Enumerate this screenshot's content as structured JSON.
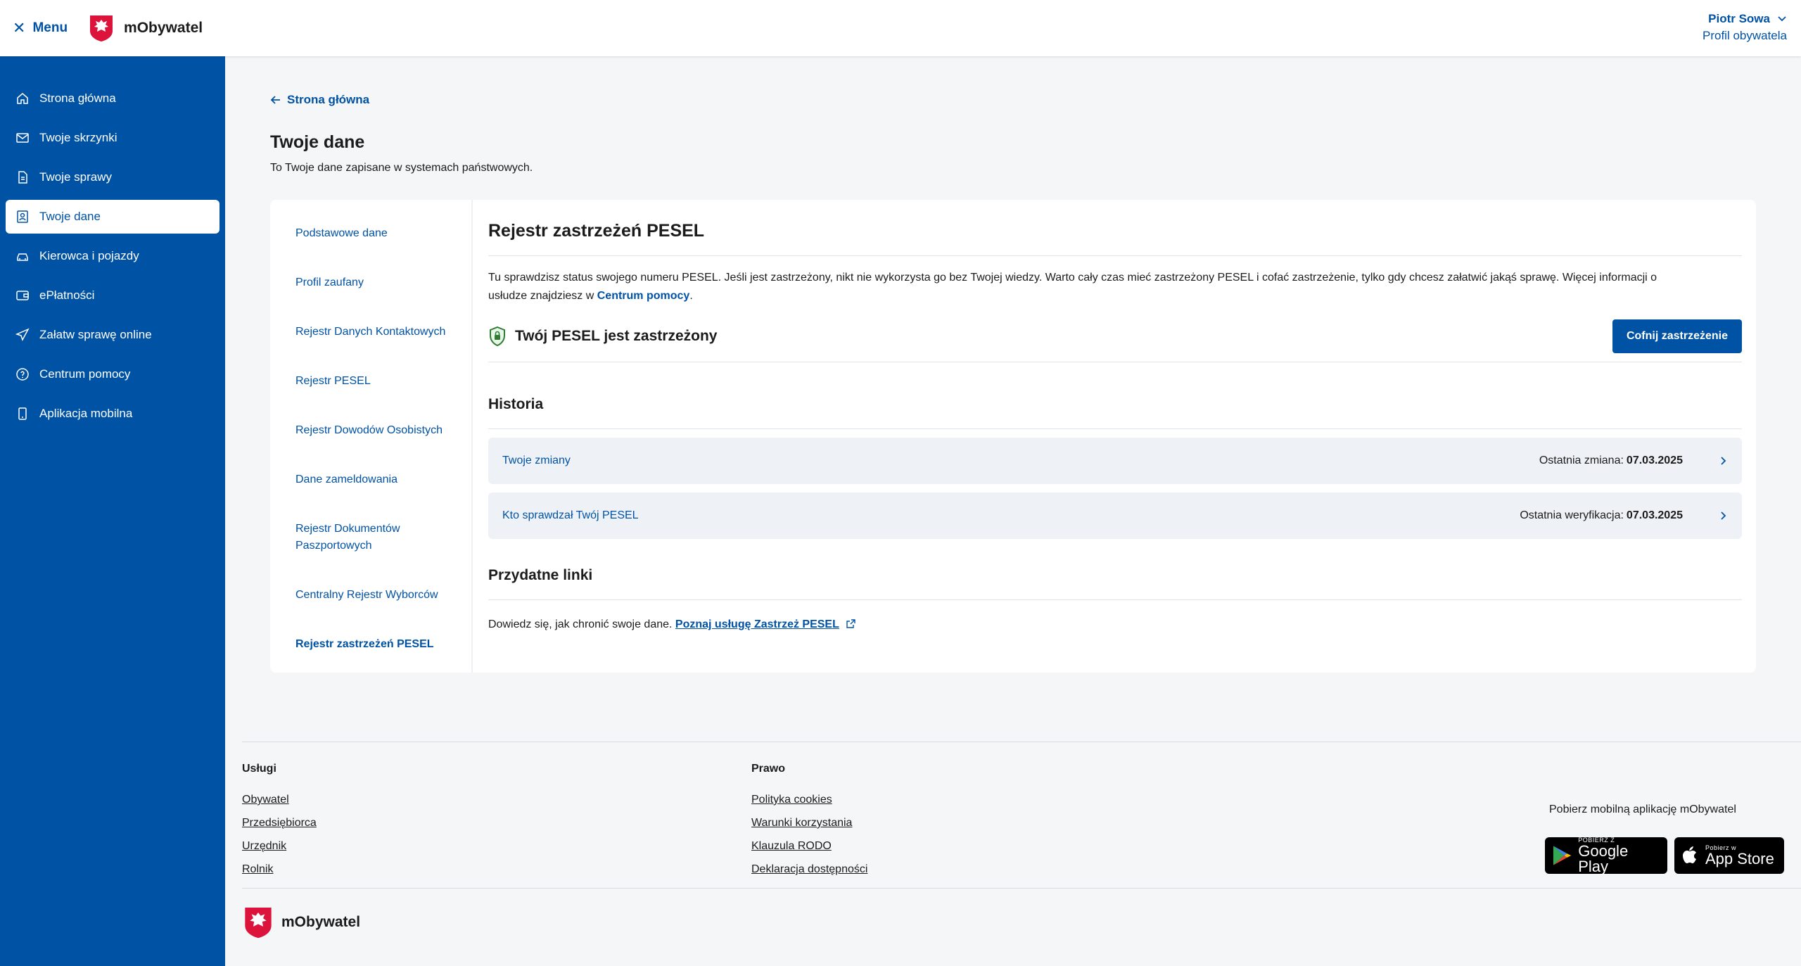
{
  "header": {
    "menu_label": "Menu",
    "brand_name": "mObywatel",
    "user_name": "Piotr Sowa",
    "user_profile": "Profil obywatela"
  },
  "sidebar": {
    "items": [
      {
        "label": "Strona główna",
        "icon": "home-icon"
      },
      {
        "label": "Twoje skrzynki",
        "icon": "mail-icon"
      },
      {
        "label": "Twoje sprawy",
        "icon": "document-icon"
      },
      {
        "label": "Twoje dane",
        "icon": "id-card-icon"
      },
      {
        "label": "Kierowca i pojazdy",
        "icon": "car-icon"
      },
      {
        "label": "ePłatności",
        "icon": "wallet-icon"
      },
      {
        "label": "Załatw sprawę online",
        "icon": "send-icon"
      },
      {
        "label": "Centrum pomocy",
        "icon": "help-icon"
      },
      {
        "label": "Aplikacja mobilna",
        "icon": "phone-icon"
      }
    ]
  },
  "main": {
    "back_label": "Strona główna",
    "title": "Twoje dane",
    "subtitle": "To Twoje dane zapisane w systemach państwowych.",
    "nav": [
      "Podstawowe dane",
      "Profil zaufany",
      "Rejestr Danych Kontaktowych",
      "Rejestr PESEL",
      "Rejestr Dowodów Osobistych",
      "Dane zameldowania",
      "Rejestr Dokumentów Paszportowych",
      "Centralny Rejestr Wyborców",
      "Rejestr zastrzeżeń PESEL"
    ],
    "detail": {
      "heading": "Rejestr zastrzeżeń PESEL",
      "desc_text": "Tu sprawdzisz status swojego numeru PESEL. Jeśli jest zastrzeżony, nikt nie wykorzysta go bez Twojej wiedzy. Warto cały czas mieć zastrzeżony PESEL i cofać zastrzeżenie, tylko gdy chcesz załatwić jakąś sprawę. Więcej informacji o usłudze znajdziesz w",
      "desc_link": "Centrum pomocy",
      "desc_end": ".",
      "status": "Twój PESEL jest zastrzeżony",
      "revoke_button": "Cofnij zastrzeżenie",
      "history_title": "Historia",
      "history": [
        {
          "label": "Twoje zmiany",
          "meta": "Ostatnia zmiana:",
          "date": "07.03.2025"
        },
        {
          "label": "Kto sprawdzał Twój PESEL",
          "meta": "Ostatnia weryfikacja:",
          "date": "07.03.2025"
        }
      ],
      "links_title": "Przydatne linki",
      "links_text": "Dowiedz się, jak chronić swoje dane.",
      "links_link": "Poznaj usługę Zastrzeż PESEL"
    }
  },
  "footer": {
    "col1_title": "Usługi",
    "col1_links": [
      "Obywatel",
      "Przedsiębiorca",
      "Urzędnik",
      "Rolnik"
    ],
    "col2_title": "Prawo",
    "col2_links": [
      "Polityka cookies",
      "Warunki korzystania",
      "Klauzula RODO",
      "Deklaracja dostępności"
    ],
    "app_text": "Pobierz mobilną aplikację mObywatel",
    "google_small": "POBIERZ Z",
    "google_big": "Google Play",
    "apple_small": "Pobierz w",
    "apple_big": "App Store",
    "brand_name": "mObywatel"
  },
  "colors": {
    "primary": "#0052a5",
    "emblem_red": "#dc143c",
    "status_green": "#2e7d32"
  }
}
